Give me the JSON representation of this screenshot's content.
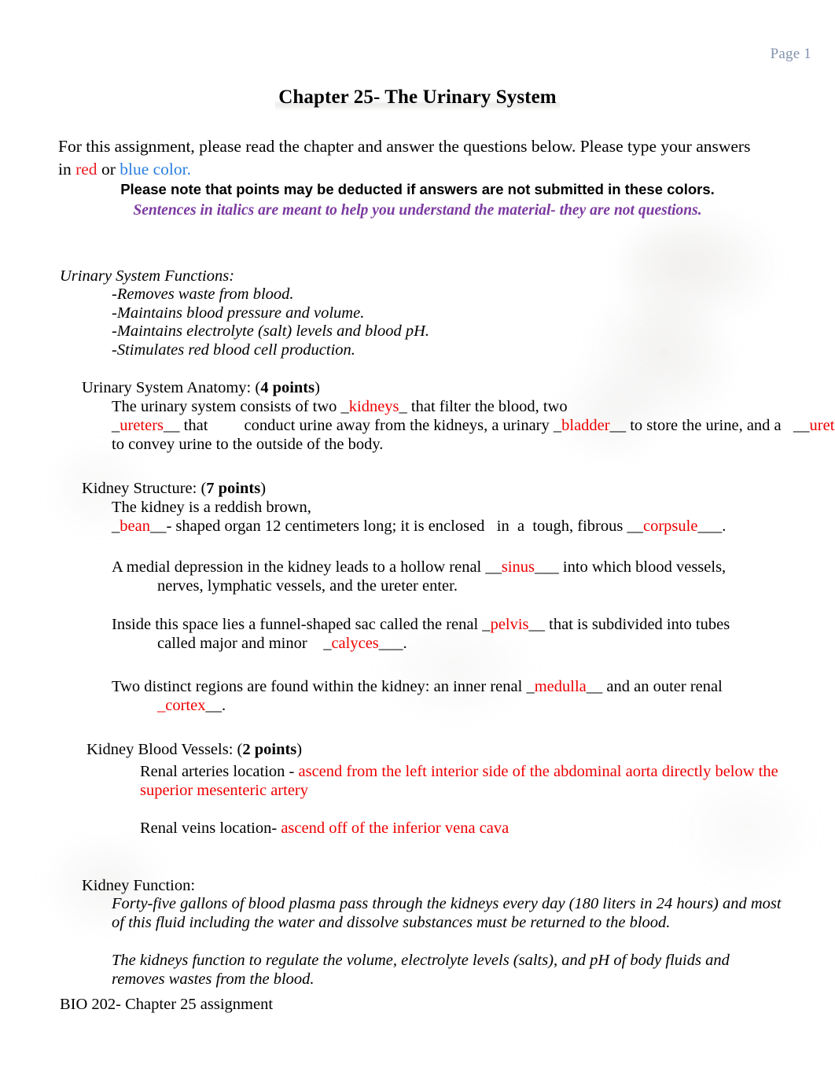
{
  "header": {
    "page_number": "Page 1",
    "title": "Chapter 25- The Urinary System"
  },
  "intro": {
    "line1_a": "For this assignment, please read the chapter and answer the questions below. Please type your answers in ",
    "red_word": "red",
    "line1_b": " or ",
    "blue_word": "blue color.",
    "note_bold": "Please note that points may be deducted if answers are not submitted in these colors.",
    "note_italic": "Sentences in italics are meant to help you understand the material- they are not questions."
  },
  "functions": {
    "heading": "Urinary System Functions:",
    "items": [
      "-Removes waste from blood.",
      "-Maintains blood pressure and volume.",
      "-Maintains electrolyte (salt) levels and blood pH.",
      "-Stimulates red blood cell production."
    ]
  },
  "anatomy": {
    "heading_label": "Urinary System Anatomy: (",
    "heading_points": "4 points",
    "heading_close": ")",
    "t1": "The urinary system consists of two ",
    "b1_pre": "_",
    "b1": "kidneys",
    "b1_post": "_",
    "t2": " that filter the blood, two ",
    "b2_pre": "_",
    "b2": "ureters",
    "b2_post": "__",
    "t3": " that         conduct urine away from the kidneys, a urinary ",
    "b3_pre": "_",
    "b3": "bladder",
    "b3_post": "__",
    "t4": " to store the urine, and a   __",
    "b4": "urethra",
    "b4_post": "__",
    "t5": " to convey urine to the outside of the body."
  },
  "kidney_structure": {
    "heading_label": "Kidney Structure: (",
    "heading_points": "7 points",
    "heading_close": ")",
    "p1_t1": "The kidney is a reddish brown, ",
    "p1_b1_pre": "_",
    "p1_b1": "bean",
    "p1_b1_post": "__",
    "p1_t2": "- shaped organ 12 centimeters long; it is enclosed   in  a  tough, fibrous __",
    "p1_b2": "corpsule",
    "p1_b2_post": "___",
    "p1_t3": ".",
    "p2_t1": "A medial depression in the kidney leads to a hollow renal __",
    "p2_b1": "sinus",
    "p2_b1_post": "___",
    "p2_t2": " into which blood vessels,",
    "p2_cont": "nerves, lymphatic vessels, and the ureter enter.",
    "p3_t1": "Inside this space lies a funnel-shaped sac called the renal _",
    "p3_b1": "pelvis",
    "p3_b1_post": "__",
    "p3_t2": " that is subdivided into tubes",
    "p3_cont_t1": "called major and minor    _",
    "p3_b2": "calyces",
    "p3_b2_post": "___",
    "p3_cont_t2": ".",
    "p4_t1": "Two distinct regions are found within the kidney: an inner renal _",
    "p4_b1": "medulla",
    "p4_b1_post": "__",
    "p4_t2": " and an outer renal",
    "p4_cont_pre": "_",
    "p4_b2": "cortex",
    "p4_b2_post": "__",
    "p4_cont_t2": "."
  },
  "kidney_blood_vessels": {
    "heading_label": "Kidney Blood Vessels: (",
    "heading_points": "2 points",
    "heading_close": ")",
    "arteries_label": "Renal arteries location - ",
    "arteries_answer": "ascend from the left interior side of the abdominal aorta directly below the superior mesenteric artery",
    "veins_label": "Renal veins location- ",
    "veins_answer": "ascend off of the inferior vena cava"
  },
  "kidney_function": {
    "heading": "Kidney Function:",
    "p1": "Forty-five gallons of blood plasma pass through the kidneys every day (180 liters in 24 hours) and most of this fluid including the water and dissolve substances must be returned to the blood.",
    "p2": "The kidneys function to regulate the volume, electrolyte levels (salts), and pH of body fluids and removes wastes from the blood."
  },
  "footer": {
    "text": "BIO 202- Chapter 25 assignment"
  },
  "colors": {
    "answer_red": "#ec1c24",
    "blue": "#2a7fe0",
    "purple": "#7b3aa0",
    "page_number": "#8193ad"
  }
}
